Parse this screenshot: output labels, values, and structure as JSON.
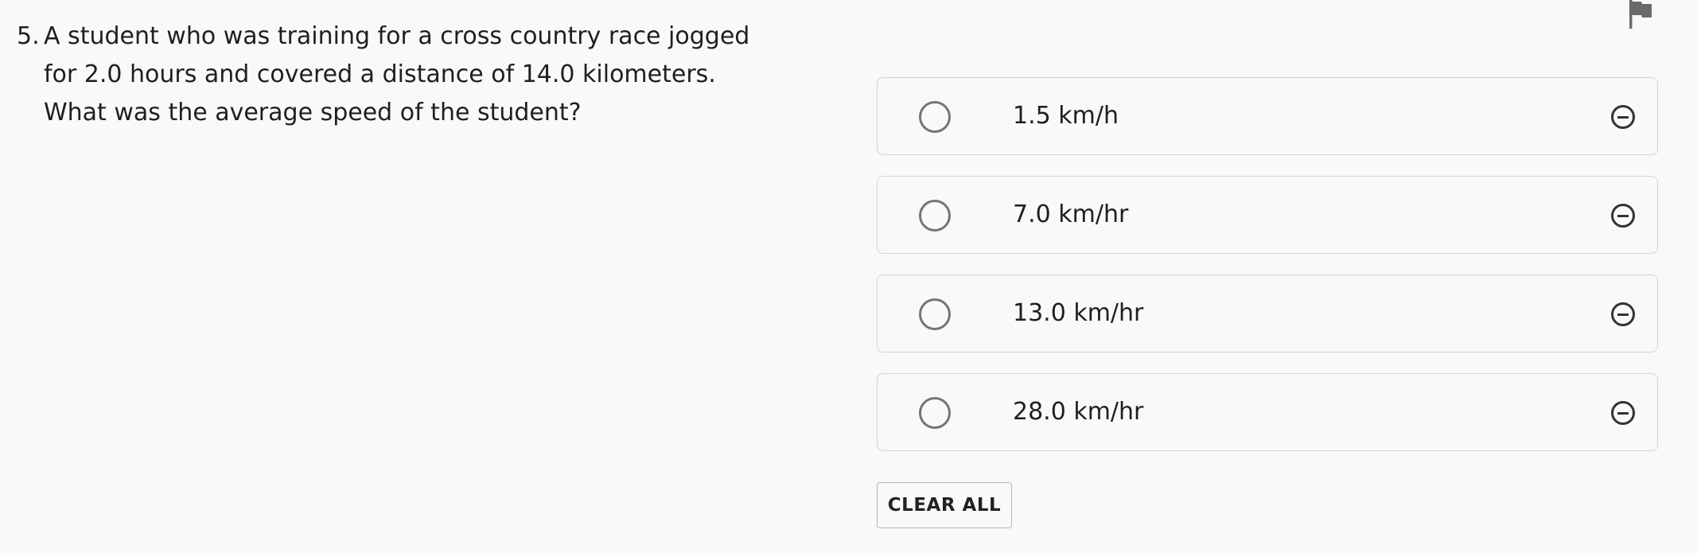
{
  "question": {
    "number": "5.",
    "text": "A student who was training for a cross country race jogged for 2.0 hours and covered a distance of 14.0 kilometers. What was the average speed of the student?"
  },
  "icons": {
    "flag": "flag-icon",
    "eliminate": "minus-circle-icon",
    "radio": "radio-circle"
  },
  "options": [
    {
      "label": "1.5 km/h"
    },
    {
      "label": "7.0 km/hr"
    },
    {
      "label": "13.0 km/hr"
    },
    {
      "label": "28.0 km/hr"
    }
  ],
  "actions": {
    "clear_all_label": "CLEAR ALL"
  },
  "colors": {
    "background": "#f9f9f9",
    "border": "#d4d4d4",
    "radio": "#757575",
    "flag": "#6a6a6a"
  }
}
